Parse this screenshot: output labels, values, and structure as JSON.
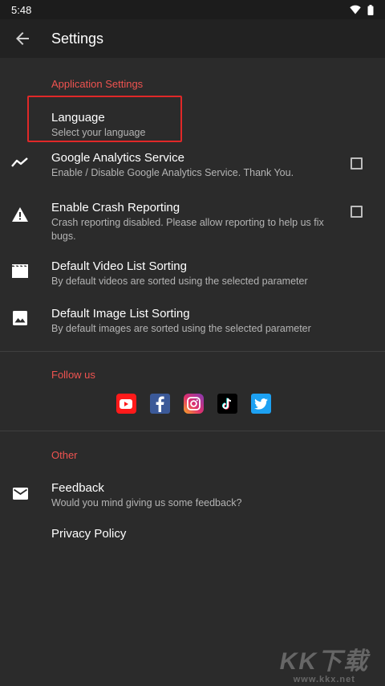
{
  "status": {
    "time": "5:48"
  },
  "app_bar": {
    "title": "Settings"
  },
  "colors": {
    "accent": "#ef5350",
    "background": "#2b2b2b",
    "highlight": "#e02828"
  },
  "app_settings": {
    "header": "Application Settings",
    "language": {
      "title": "Language",
      "summary": "Select your language"
    },
    "analytics": {
      "title": "Google Analytics Service",
      "summary": "Enable / Disable Google Analytics Service. Thank You.",
      "checked": false
    },
    "crash": {
      "title": "Enable Crash Reporting",
      "summary": "Crash reporting disabled. Please allow reporting to help us fix bugs.",
      "checked": false
    },
    "video_sort": {
      "title": "Default Video List Sorting",
      "summary": "By default videos are sorted using the selected parameter"
    },
    "image_sort": {
      "title": "Default Image List Sorting",
      "summary": "By default images are sorted using the selected parameter"
    }
  },
  "follow": {
    "header": "Follow us",
    "icons": [
      "youtube-icon",
      "facebook-icon",
      "instagram-icon",
      "tiktok-icon",
      "twitter-icon"
    ]
  },
  "other": {
    "header": "Other",
    "feedback": {
      "title": "Feedback",
      "summary": "Would you mind giving us some feedback?"
    },
    "privacy": {
      "title": "Privacy Policy"
    }
  },
  "watermark": {
    "main": "KK下载",
    "sub": "www.kkx.net"
  }
}
